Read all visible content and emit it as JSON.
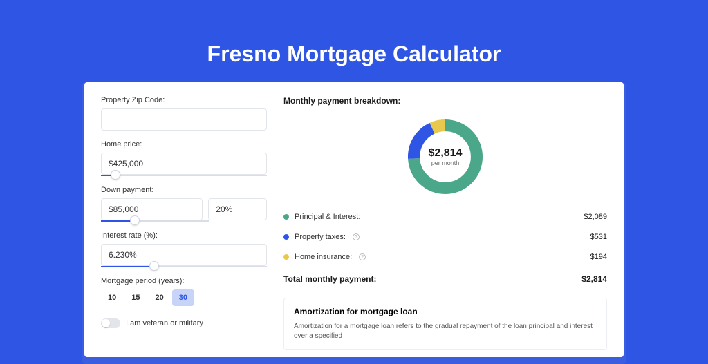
{
  "title": "Fresno Mortgage Calculator",
  "form": {
    "zip_label": "Property Zip Code:",
    "zip_value": "",
    "home_price_label": "Home price:",
    "home_price_value": "$425,000",
    "down_payment_label": "Down payment:",
    "down_payment_value": "$85,000",
    "down_payment_pct": "20%",
    "interest_label": "Interest rate (%):",
    "interest_value": "6.230%",
    "period_label": "Mortgage period (years):",
    "period_options": [
      "10",
      "15",
      "20",
      "30"
    ],
    "period_selected": "30",
    "veteran_label": "I am veteran or military"
  },
  "breakdown": {
    "heading": "Monthly payment breakdown:",
    "center_amount": "$2,814",
    "center_sub": "per month",
    "items": [
      {
        "label": "Principal & Interest:",
        "value": "$2,089",
        "color": "#4aa789",
        "pct": 74
      },
      {
        "label": "Property taxes:",
        "value": "$531",
        "color": "#2f55e5",
        "pct": 19,
        "info": true
      },
      {
        "label": "Home insurance:",
        "value": "$194",
        "color": "#e9c84e",
        "pct": 7,
        "info": true
      }
    ],
    "total_label": "Total monthly payment:",
    "total_value": "$2,814"
  },
  "amortization": {
    "title": "Amortization for mortgage loan",
    "text": "Amortization for a mortgage loan refers to the gradual repayment of the loan principal and interest over a specified"
  },
  "chart_data": {
    "type": "pie",
    "title": "Monthly payment breakdown",
    "series": [
      {
        "name": "Principal & Interest",
        "value": 2089,
        "color": "#4aa789"
      },
      {
        "name": "Property taxes",
        "value": 531,
        "color": "#2f55e5"
      },
      {
        "name": "Home insurance",
        "value": 194,
        "color": "#e9c84e"
      }
    ],
    "total": 2814,
    "center_label": "$2,814 per month"
  }
}
